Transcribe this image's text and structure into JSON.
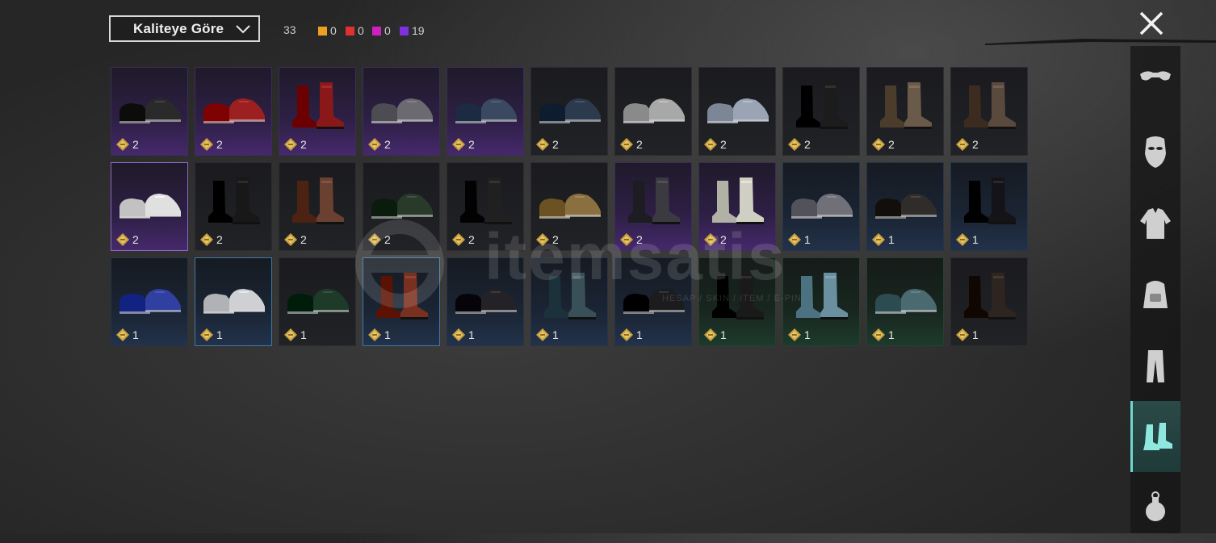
{
  "header": {
    "sort_label": "Kaliteye Göre",
    "total_count": "33",
    "quality_counts": [
      {
        "color": "#f0a020",
        "count": "0"
      },
      {
        "color": "#e03030",
        "count": "0"
      },
      {
        "color": "#d020c0",
        "count": "0"
      },
      {
        "color": "#8030e0",
        "count": "19"
      }
    ]
  },
  "watermark": {
    "text": "itemsatis",
    "subtitle": "HESAP / SKIN / ITEM / E-PIN"
  },
  "items": [
    {
      "rarity": "purple",
      "count": "2",
      "icon": "black-hightop-sneakers-icon",
      "color": "#2a2a2a"
    },
    {
      "rarity": "purple",
      "count": "2",
      "icon": "red-sneakers-icon",
      "color": "#9c2020"
    },
    {
      "rarity": "purple",
      "count": "2",
      "icon": "red-tall-boots-icon",
      "color": "#8a1818"
    },
    {
      "rarity": "purple",
      "count": "2",
      "icon": "grey-hightop-sneakers-icon",
      "color": "#6a6a70"
    },
    {
      "rarity": "purple",
      "count": "2",
      "icon": "blue-loafers-icon",
      "color": "#3a4860"
    },
    {
      "rarity": "dark",
      "count": "2",
      "icon": "flip-flops-icon",
      "color": "#2c3a4e"
    },
    {
      "rarity": "dark",
      "count": "2",
      "icon": "white-sneakers-icon",
      "color": "#a8a8a8"
    },
    {
      "rarity": "dark",
      "count": "2",
      "icon": "sandals-icon",
      "color": "#9aa4b4"
    },
    {
      "rarity": "dark",
      "count": "2",
      "icon": "black-tall-boots-icon",
      "color": "#1c1c1c"
    },
    {
      "rarity": "dark",
      "count": "2",
      "icon": "brown-lace-boots-icon",
      "color": "#6a5a4a"
    },
    {
      "rarity": "dark",
      "count": "2",
      "icon": "brown-cuff-boots-icon",
      "color": "#5a4a3e"
    },
    {
      "rarity": "purple",
      "count": "2",
      "icon": "checkered-sneakers-icon",
      "color": "#e0e0e0",
      "selected": true
    },
    {
      "rarity": "dark",
      "count": "2",
      "icon": "black-knee-boots-icon",
      "color": "#181818"
    },
    {
      "rarity": "dark",
      "count": "2",
      "icon": "brown-combat-boots-icon",
      "color": "#6a4030"
    },
    {
      "rarity": "dark",
      "count": "2",
      "icon": "black-green-sneakers-icon",
      "color": "#2a3a2a"
    },
    {
      "rarity": "dark",
      "count": "2",
      "icon": "black-work-boots-icon",
      "color": "#202020"
    },
    {
      "rarity": "dark",
      "count": "2",
      "icon": "tan-moccasins-icon",
      "color": "#8a7040"
    },
    {
      "rarity": "purple",
      "count": "2",
      "icon": "grey-ankle-boots-icon",
      "color": "#3a3a40"
    },
    {
      "rarity": "purple",
      "count": "2",
      "icon": "white-boots-icon",
      "color": "#d0cfc4"
    },
    {
      "rarity": "blue",
      "count": "1",
      "icon": "grey-shoes-icon",
      "color": "#707078"
    },
    {
      "rarity": "blue",
      "count": "1",
      "icon": "dark-loafers-icon",
      "color": "#302c2a"
    },
    {
      "rarity": "blue",
      "count": "1",
      "icon": "black-tall-boots-icon",
      "color": "#141418"
    },
    {
      "rarity": "blue",
      "count": "1",
      "icon": "blue-velcro-shoes-icon",
      "color": "#3040a0"
    },
    {
      "rarity": "blue",
      "count": "1",
      "icon": "white-slip-ons-icon",
      "color": "#cfd0d4",
      "selected": true
    },
    {
      "rarity": "dark",
      "count": "1",
      "icon": "green-shoes-icon",
      "color": "#1e3a28"
    },
    {
      "rarity": "blue",
      "count": "1",
      "icon": "red-brown-boots-icon",
      "color": "#7a3020",
      "selected": true
    },
    {
      "rarity": "blue",
      "count": "1",
      "icon": "dark-loafers-icon",
      "color": "#242226"
    },
    {
      "rarity": "blue",
      "count": "1",
      "icon": "teal-boots-icon",
      "color": "#3a5058"
    },
    {
      "rarity": "blue",
      "count": "1",
      "icon": "black-oxfords-icon",
      "color": "#1c1c1e"
    },
    {
      "rarity": "green",
      "count": "1",
      "icon": "black-combat-boots-icon",
      "color": "#1a1a1a"
    },
    {
      "rarity": "green",
      "count": "1",
      "icon": "light-blue-boots-icon",
      "color": "#6a90a0"
    },
    {
      "rarity": "green",
      "count": "1",
      "icon": "teal-sneakers-icon",
      "color": "#4a6a70"
    },
    {
      "rarity": "dark",
      "count": "1",
      "icon": "dark-brown-boots-icon",
      "color": "#2e2420"
    }
  ],
  "sidebar": [
    {
      "icon": "glasses-icon",
      "active": false
    },
    {
      "icon": "mask-icon",
      "active": false
    },
    {
      "icon": "jacket-icon",
      "active": false
    },
    {
      "icon": "backpack-icon",
      "active": false
    },
    {
      "icon": "pants-icon",
      "active": false
    },
    {
      "icon": "shoes-icon",
      "active": true
    },
    {
      "icon": "grenade-icon",
      "active": false
    }
  ]
}
